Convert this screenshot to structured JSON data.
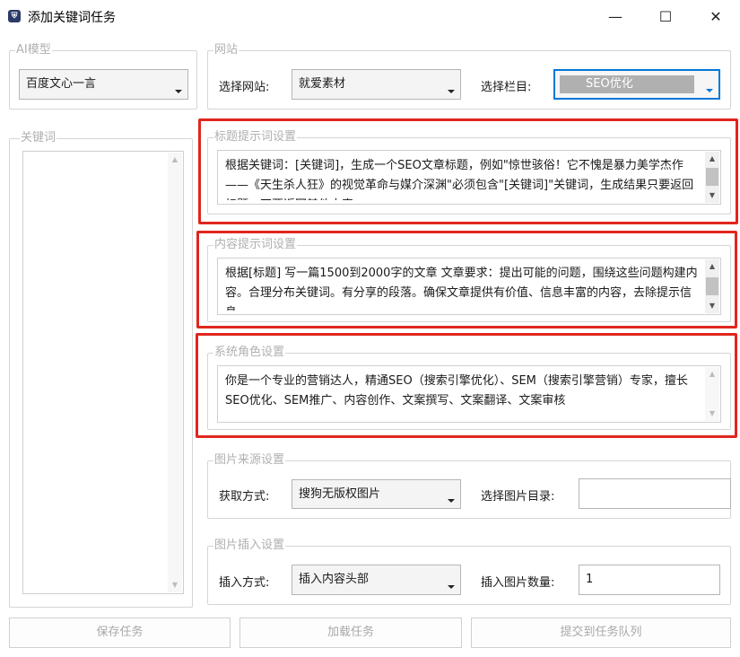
{
  "window": {
    "title": "添加关键词任务",
    "icon_glyph": "⛨",
    "minimize_glyph": "—",
    "maximize_glyph": "☐",
    "close_glyph": "✕"
  },
  "ai_model": {
    "group_title": "AI模型",
    "selected": "百度文心一言"
  },
  "website": {
    "group_title": "网站",
    "site_label": "选择网站:",
    "site_value": "就爱素材",
    "column_label": "选择栏目:",
    "column_value": "SEO优化"
  },
  "keywords": {
    "group_title": "关键词"
  },
  "title_prompt": {
    "group_title": "标题提示词设置",
    "text": "根据关键词：[关键词]，生成一个SEO文章标题，例如\"惊世骇俗！它不愧是暴力美学杰作——《天生杀人狂》的视觉革命与媒介深渊\"必须包含\"[关键词]\"关键词，生成结果只要返回标题，不要返回其他内容"
  },
  "content_prompt": {
    "group_title": "内容提示词设置",
    "text": "根据[标题] 写一篇1500到2000字的文章 文章要求：提出可能的问题，围绕这些问题构建内容。合理分布关键词。有分享的段落。确保文章提供有价值、信息丰富的内容，去除提示信息"
  },
  "system_role": {
    "group_title": "系统角色设置",
    "text": "你是一个专业的营销达人，精通SEO（搜索引擎优化）、SEM（搜索引擎营销）专家，擅长SEO优化、SEM推广、内容创作、文案撰写、文案翻译、文案审核"
  },
  "image_source": {
    "group_title": "图片来源设置",
    "method_label": "获取方式:",
    "method_value": "搜狗无版权图片",
    "dir_label": "选择图片目录:",
    "dir_value": ""
  },
  "image_insert": {
    "group_title": "图片插入设置",
    "method_label": "插入方式:",
    "method_value": "插入内容头部",
    "count_label": "插入图片数量:",
    "count_value": "1"
  },
  "buttons": {
    "save": "保存任务",
    "load": "加载任务",
    "submit": "提交到任务队列"
  },
  "scroll_glyphs": {
    "up": "▲",
    "down": "▼"
  },
  "colors": {
    "highlight_frame": "#e0261e",
    "selection_bg": "#0078d7",
    "disabled_text": "#a8a8a8"
  }
}
